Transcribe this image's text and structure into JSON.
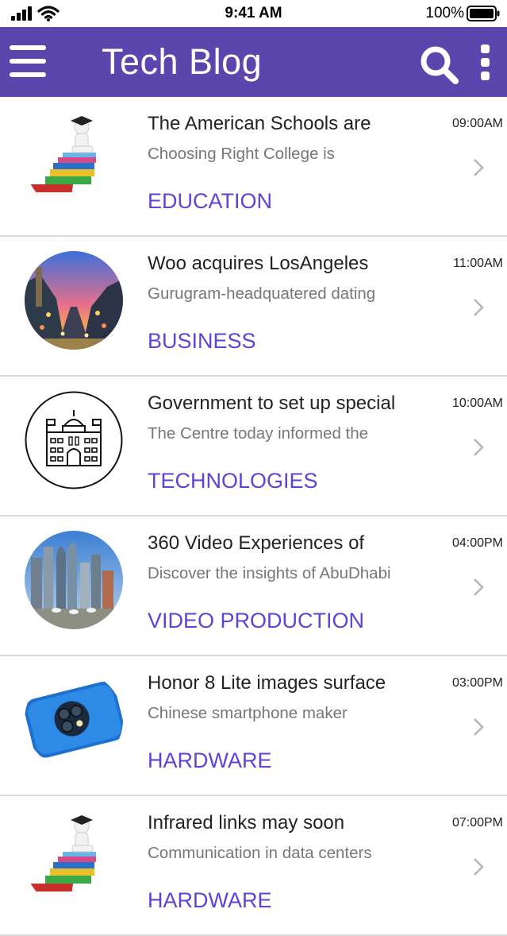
{
  "status_bar": {
    "time": "9:41 AM",
    "battery_percent": "100%",
    "icons": [
      "cellular-signal-icon",
      "wifi-icon",
      "battery-icon"
    ]
  },
  "nav_bar": {
    "title": "Tech Blog",
    "background": "#5a46ad",
    "icons": [
      "hamburger-menu-icon",
      "search-icon",
      "more-vertical-icon"
    ]
  },
  "feed": {
    "accent_color": "#5a46d6",
    "items": [
      {
        "title": "The American Schools are",
        "summary": "Choosing Right College is",
        "category": "EDUCATION",
        "time": "09:00AM",
        "thumbnail": "graduate-on-books-image"
      },
      {
        "title": "Woo acquires LosAngeles",
        "summary": "Gurugram-headquatered dating",
        "category": "BUSINESS",
        "time": "11:00AM",
        "thumbnail": "los-angeles-street-photo"
      },
      {
        "title": "Government to set up special",
        "summary": "The Centre today informed the",
        "category": "TECHNOLOGIES",
        "time": "10:00AM",
        "thumbnail": "government-building-icon"
      },
      {
        "title": "360 Video Experiences of",
        "summary": "Discover the insights of AbuDhabi",
        "category": "VIDEO PRODUCTION",
        "time": "04:00PM",
        "thumbnail": "abu-dhabi-skyline-photo"
      },
      {
        "title": "Honor 8 Lite images surface",
        "summary": "Chinese smartphone maker",
        "category": "HARDWARE",
        "time": "03:00PM",
        "thumbnail": "blue-smartphone-photo"
      },
      {
        "title": "Infrared links may soon",
        "summary": "Communication in data centers",
        "category": "HARDWARE",
        "time": "07:00PM",
        "thumbnail": "graduate-on-books-image"
      }
    ]
  }
}
